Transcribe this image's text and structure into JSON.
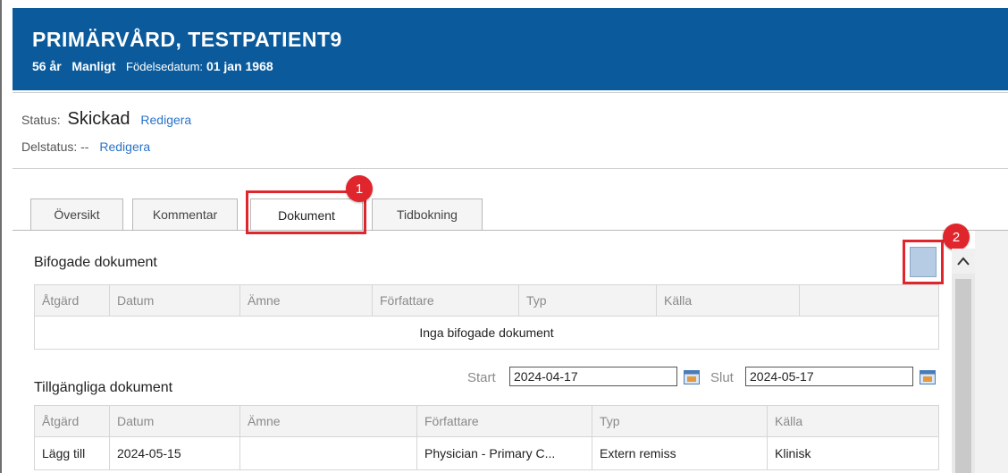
{
  "patient": {
    "name": "PRIMÄRVÅRD, TESTPATIENT9",
    "age": "56 år",
    "gender": "Manligt",
    "dob_label": "Födelsedatum:",
    "dob": "01 jan 1968"
  },
  "status": {
    "label": "Status:",
    "value": "Skickad",
    "edit": "Redigera",
    "sub_label": "Delstatus:",
    "sub_value": "--",
    "sub_edit": "Redigera"
  },
  "tabs": [
    {
      "label": "Översikt"
    },
    {
      "label": "Kommentar"
    },
    {
      "label": "Dokument",
      "active": true
    },
    {
      "label": "Tidbokning"
    }
  ],
  "callouts": [
    "1",
    "2"
  ],
  "attached": {
    "title": "Bifogade dokument",
    "columns": [
      "Åtgärd",
      "Datum",
      "Ämne",
      "Författare",
      "Typ",
      "Källa"
    ],
    "empty_text": "Inga bifogade dokument"
  },
  "available": {
    "title": "Tillgängliga dokument",
    "start_label": "Start",
    "start_value": "2024-04-17",
    "end_label": "Slut",
    "end_value": "2024-05-17",
    "columns": [
      "Åtgärd",
      "Datum",
      "Ämne",
      "Författare",
      "Typ",
      "Källa"
    ],
    "rows": [
      {
        "action": "Lägg till",
        "date": "2024-05-15",
        "subject": "",
        "author": "Physician - Primary C...",
        "type": "Extern remiss",
        "source": "Klinisk"
      }
    ]
  },
  "colors": {
    "header_bg": "#0b5b9c",
    "link": "#2a73c9",
    "highlight": "#e0262c"
  },
  "icons": [
    "calendar-icon",
    "chevron-up-icon",
    "document-view-icon"
  ]
}
